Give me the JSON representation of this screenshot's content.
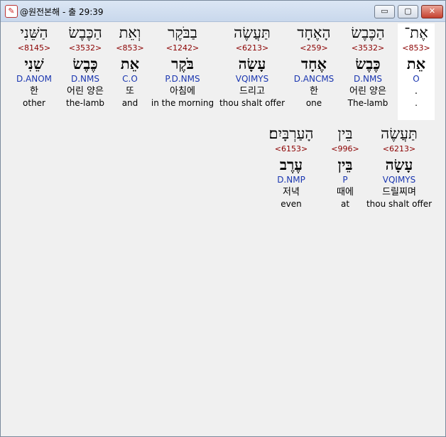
{
  "window": {
    "title": "@원전본해 - 출 29:39",
    "icon": "app-logo-icon",
    "buttons": {
      "minimize": "▭",
      "maximize": "▢",
      "close": "✕"
    }
  },
  "rows": [
    {
      "words": [
        {
          "hebrew": "אֶת־",
          "strong": "<853>",
          "lemma": "אֵת",
          "parse": "O",
          "korean": ".",
          "english": "."
        },
        {
          "hebrew": "הַכֶּבֶשׂ",
          "strong": "<3532>",
          "lemma": "כֶּבֶשׂ",
          "parse": "D.NMS",
          "korean": "어린 양은",
          "english": "The-lamb"
        },
        {
          "hebrew": "הָאֶחָד",
          "strong": "<259>",
          "lemma": "אֶחָד",
          "parse": "D.ANCMS",
          "korean": "한",
          "english": "one"
        },
        {
          "hebrew": "תַּעֲשֶׂה",
          "strong": "<6213>",
          "lemma": "עָשָׂה",
          "parse": "VQIMYS",
          "korean": "드리고",
          "english": "thou shalt offer"
        },
        {
          "hebrew": "בַבֹּקֶר",
          "strong": "<1242>",
          "lemma": "בֹּקֶר",
          "parse": "P.D.NMS",
          "korean": "아침에",
          "english": "in the morning"
        },
        {
          "hebrew": "וְאֵת",
          "strong": "<853>",
          "lemma": "אֵת",
          "parse": "C.O",
          "korean": "또",
          "english": "and"
        },
        {
          "hebrew": "הַכֶּבֶשׂ",
          "strong": "<3532>",
          "lemma": "כֶּבֶשׂ",
          "parse": "D.NMS",
          "korean": "어린 양은",
          "english": "the-lamb"
        },
        {
          "hebrew": "הַשֵּׁנִי",
          "strong": "<8145>",
          "lemma": "שֵׁנִי",
          "parse": "D.ANOM",
          "korean": "한",
          "english": "other"
        }
      ]
    },
    {
      "words": [
        {
          "hebrew": "תַּעֲשֶׂה",
          "strong": "<6213>",
          "lemma": "עָשָׂה",
          "parse": "VQIMYS",
          "korean": "드릴찌며",
          "english": "thou shalt offer"
        },
        {
          "hebrew": "בֵּין",
          "strong": "<996>",
          "lemma": "בֵּין",
          "parse": "P",
          "korean": "때에",
          "english": "at"
        },
        {
          "hebrew": "הָעַרְבָּיִם׃",
          "strong": "<6153>",
          "lemma": "עֶרֶב",
          "parse": "D.NMP",
          "korean": "저녁",
          "english": "even"
        }
      ]
    }
  ]
}
